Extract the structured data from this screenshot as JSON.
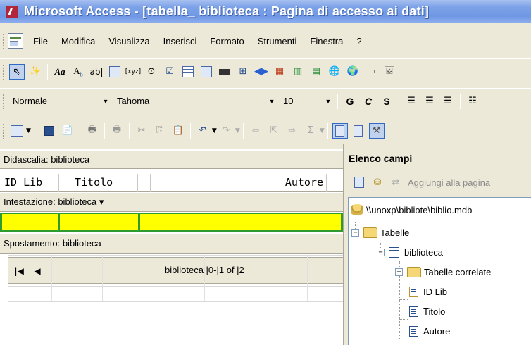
{
  "window": {
    "title": "Microsoft Access - [tabella_ biblioteca : Pagina di accesso ai dati]"
  },
  "menu": {
    "items": [
      "File",
      "Modifica",
      "Visualizza",
      "Inserisci",
      "Formato",
      "Strumenti",
      "Finestra",
      "?"
    ]
  },
  "format_toolbar": {
    "style": "Normale",
    "font": "Tahoma",
    "size": "10",
    "bold": "G",
    "italic": "C",
    "underline": "S"
  },
  "form": {
    "caption_label": "Didascalia: biblioteca",
    "columns": [
      "ID Lib",
      "Titolo",
      "Autore"
    ],
    "header_label": "Intestazione: biblioteca ▾",
    "navigation_label": "Spostamento: biblioteca",
    "record_status": "biblioteca |0-|1 of |2",
    "nav_first": "|◀",
    "nav_prev": "◀"
  },
  "field_list": {
    "title": "Elenco campi",
    "add_to_page": "Aggiungi alla pagina",
    "db_path": "\\\\unoxp\\bibliote\\biblio.mdb",
    "tables_label": "Tabelle",
    "table_name": "biblioteca",
    "related_label": "Tabelle correlate",
    "fields": [
      "ID Lib",
      "Titolo",
      "Autore"
    ]
  },
  "colors": {
    "title_gradient": "#6f97e4",
    "header_fill": "#ffff00",
    "header_border": "#2e9b2e",
    "selection": "#316ac5"
  }
}
